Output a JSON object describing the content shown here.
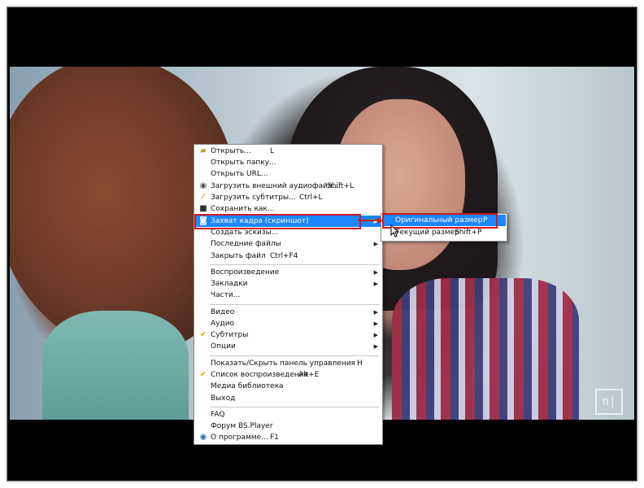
{
  "menu": {
    "items": [
      {
        "label": "Открыть...",
        "shortcut": "L",
        "icon": "folder-open-icon"
      },
      {
        "label": "Открыть папку...",
        "shortcut": "",
        "icon": ""
      },
      {
        "label": "Открыть URL...",
        "shortcut": "",
        "icon": ""
      },
      {
        "label": "Загрузить внешний аудиофайл...",
        "shortcut": "Shift+L",
        "icon": "audio-file-icon"
      },
      {
        "label": "Загрузить субтитры...",
        "shortcut": "Ctrl+L",
        "icon": "pencil-icon"
      },
      {
        "label": "Сохранить как...",
        "shortcut": "",
        "icon": "floppy-disk-icon"
      },
      {
        "label": "Захват кадра (скриншот)",
        "shortcut": "",
        "icon": "camera-icon",
        "submenu": true,
        "highlighted": true
      },
      {
        "label": "Создать эскизы...",
        "shortcut": "",
        "icon": ""
      },
      {
        "label": "Последние файлы",
        "shortcut": "",
        "icon": "",
        "submenu": true
      },
      {
        "label": "Закрыть файл",
        "shortcut": "Ctrl+F4",
        "icon": ""
      },
      {
        "label": "Воспроизведение",
        "shortcut": "",
        "icon": "",
        "submenu": true
      },
      {
        "label": "Закладки",
        "shortcut": "",
        "icon": "",
        "submenu": true
      },
      {
        "label": "Части...",
        "shortcut": "",
        "icon": ""
      },
      {
        "label": "Видео",
        "shortcut": "",
        "icon": "",
        "submenu": true
      },
      {
        "label": "Аудио",
        "shortcut": "",
        "icon": "",
        "submenu": true
      },
      {
        "label": "Субтитры",
        "shortcut": "",
        "icon": "checkmark-icon",
        "submenu": true
      },
      {
        "label": "Опции",
        "shortcut": "",
        "icon": "",
        "submenu": true
      },
      {
        "label": "Показать/Скрыть панель управления",
        "shortcut": "H",
        "icon": ""
      },
      {
        "label": "Список воспроизведения",
        "shortcut": "Alt+E",
        "icon": "checkmark-icon"
      },
      {
        "label": "Медиа библиотека",
        "shortcut": "",
        "icon": ""
      },
      {
        "label": "Выход",
        "shortcut": "",
        "icon": ""
      },
      {
        "label": "FAQ",
        "shortcut": "",
        "icon": ""
      },
      {
        "label": "Форум BS.Player",
        "shortcut": "",
        "icon": ""
      },
      {
        "label": "О программе...",
        "shortcut": "F1",
        "icon": "info-icon"
      }
    ]
  },
  "submenu": {
    "items": [
      {
        "label": "Оригинальный размер",
        "shortcut": "P",
        "highlighted": true
      },
      {
        "label": "Текущий размер",
        "shortcut": "Shift+P",
        "highlighted": false
      }
    ]
  },
  "watermark": {
    "text": "n|"
  },
  "colors": {
    "highlight": "#1c86ff",
    "annotation": "#d01a1a",
    "letterbox": "#000000"
  }
}
